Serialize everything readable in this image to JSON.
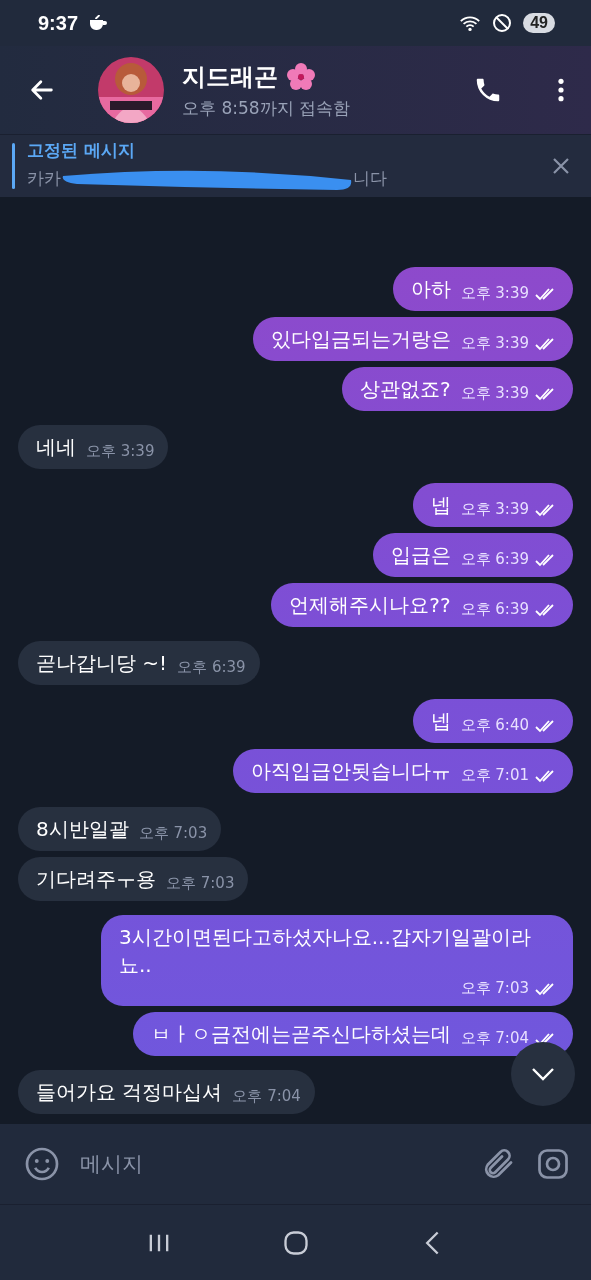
{
  "status_bar": {
    "time": "9:37",
    "battery": "49"
  },
  "header": {
    "name": "지드래곤",
    "status": "오후 8:58까지 접속함"
  },
  "pinned": {
    "title": "고정된 메시지",
    "preview_start": "카카",
    "preview_end": "니다"
  },
  "messages": [
    {
      "outgoing": true,
      "text": "아하",
      "time": "오후 3:39",
      "read": true
    },
    {
      "outgoing": true,
      "text": "있다입금되는거랑은",
      "time": "오후 3:39",
      "read": true
    },
    {
      "outgoing": true,
      "text": "상관없죠?",
      "time": "오후 3:39",
      "read": true
    },
    {
      "outgoing": false,
      "text": "네네",
      "time": "오후 3:39"
    },
    {
      "outgoing": true,
      "text": "넵",
      "time": "오후 3:39",
      "read": true
    },
    {
      "outgoing": true,
      "text": "입급은",
      "time": "오후 6:39",
      "read": true
    },
    {
      "outgoing": true,
      "text": "언제해주시나요??",
      "time": "오후 6:39",
      "read": true
    },
    {
      "outgoing": false,
      "text": "곧나갑니당 ~!",
      "time": "오후 6:39"
    },
    {
      "outgoing": true,
      "text": "넵",
      "time": "오후 6:40",
      "read": true
    },
    {
      "outgoing": true,
      "text": "아직입급안됫습니다ㅠ",
      "time": "오후 7:01",
      "read": true
    },
    {
      "outgoing": false,
      "text": "8시반일괄",
      "time": "오후 7:03"
    },
    {
      "outgoing": false,
      "text": "기다려주ㅜ용",
      "time": "오후 7:03"
    },
    {
      "outgoing": true,
      "text": "3시간이면된다고하셨자나요...갑자기일괄이라뇨..",
      "time": "오후 7:03",
      "read": true
    },
    {
      "outgoing": true,
      "text": "ㅂㅏㅇ금전에는곧주신다하셨는데",
      "time": "오후 7:04",
      "read": true
    },
    {
      "outgoing": false,
      "text": "들어가요 걱정마십셔",
      "time": "오후 7:04"
    }
  ],
  "composer": {
    "placeholder": "메시지"
  }
}
